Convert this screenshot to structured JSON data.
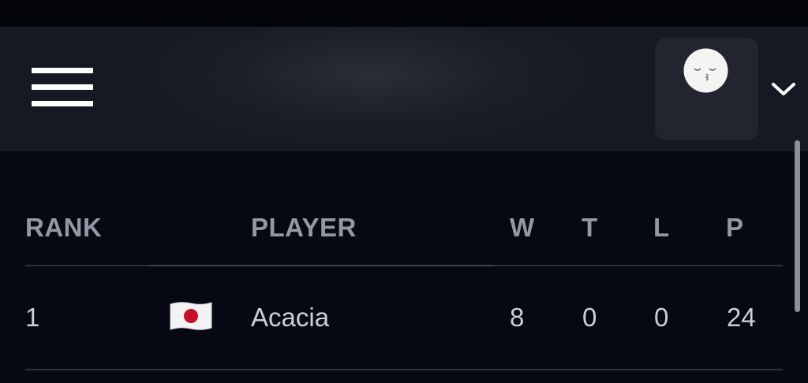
{
  "header": {
    "menu_icon": "hamburger-menu-icon",
    "avatar_icon": "kissing-face-icon",
    "dropdown_icon": "chevron-down-icon"
  },
  "leaderboard": {
    "columns": [
      "RANK",
      "PLAYER",
      "W",
      "T",
      "L",
      "P"
    ],
    "rows": [
      {
        "rank": "1",
        "flag": "japan-flag-icon",
        "player": "Acacia",
        "w": "8",
        "t": "0",
        "l": "0",
        "p": "24"
      }
    ]
  },
  "colors": {
    "background": "#060912",
    "header_bg": "#1b1e27",
    "header_text": "#9398a4",
    "row_text": "#c9ced8",
    "divider": "#2c3244"
  }
}
